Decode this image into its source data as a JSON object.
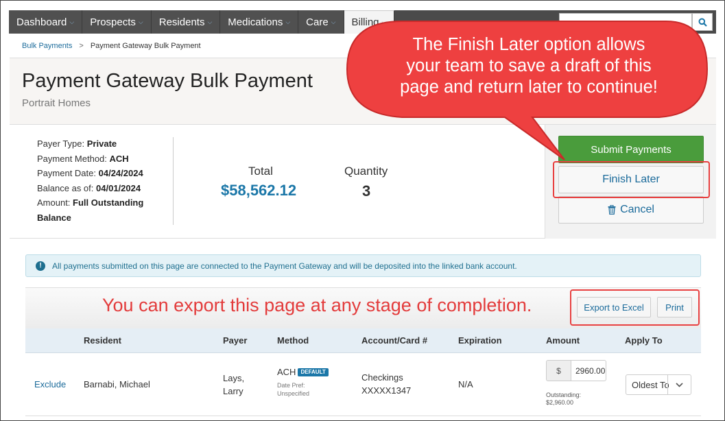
{
  "nav": {
    "items": [
      {
        "label": "Dashboard",
        "chev": "⌵"
      },
      {
        "label": "Prospects",
        "chev": "⌵"
      },
      {
        "label": "Residents",
        "chev": "⌵"
      },
      {
        "label": "Medications",
        "chev": "⌵"
      },
      {
        "label": "Care",
        "chev": "⌵"
      },
      {
        "label": "Billing",
        "chev": "⌵"
      }
    ]
  },
  "breadcrumb": {
    "parent": "Bulk Payments",
    "sep": ">",
    "current": "Payment Gateway Bulk Payment"
  },
  "header": {
    "title": "Payment Gateway Bulk Payment",
    "subtitle": "Portrait Homes"
  },
  "details": {
    "payer_type_label": "Payer Type:",
    "payer_type": "Private",
    "method_label": "Payment Method:",
    "method": "ACH",
    "date_label": "Payment Date:",
    "date": "04/24/2024",
    "balance_label": "Balance as of:",
    "balance_date": "04/01/2024",
    "amount_label": "Amount:",
    "amount_line1": "Full Outstanding",
    "amount_line2": "Balance"
  },
  "totals": {
    "total_label": "Total",
    "total_value": "$58,562.12",
    "qty_label": "Quantity",
    "qty_value": "3"
  },
  "actions": {
    "submit": "Submit Payments",
    "finish": "Finish Later",
    "cancel": "Cancel"
  },
  "alert": {
    "text": "All payments submitted on this page are connected to the Payment Gateway and will be deposited into the linked bank account."
  },
  "toolbar": {
    "export_note": "You can export this page at any stage of completion.",
    "export": "Export to Excel",
    "print": "Print"
  },
  "table": {
    "headers": [
      "Resident",
      "Payer",
      "Method",
      "Account/Card #",
      "Expiration",
      "Amount",
      "Apply To"
    ],
    "row": {
      "exclude": "Exclude",
      "resident": "Barnabi, Michael",
      "payer_line1": "Lays,",
      "payer_line2": "Larry",
      "method": "ACH",
      "badge": "DEFAULT",
      "date_pref_line1": "Date Pref:",
      "date_pref_line2": "Unspecified",
      "account_line1": "Checkings",
      "account_line2": "XXXXX1347",
      "expiration": "N/A",
      "amount_prefix": "$",
      "amount_value": "2960.00",
      "outstanding_line1": "Outstanding:",
      "outstanding_line2": "$2,960.00",
      "apply_to": "Oldest To"
    }
  },
  "callout": {
    "line1": "The Finish Later option allows",
    "line2": "your team to save a draft of this",
    "line3": "page and return later to continue!"
  },
  "colors": {
    "accent": "#1b77a8",
    "submit": "#4a9c3c",
    "callout": "#e84040"
  }
}
